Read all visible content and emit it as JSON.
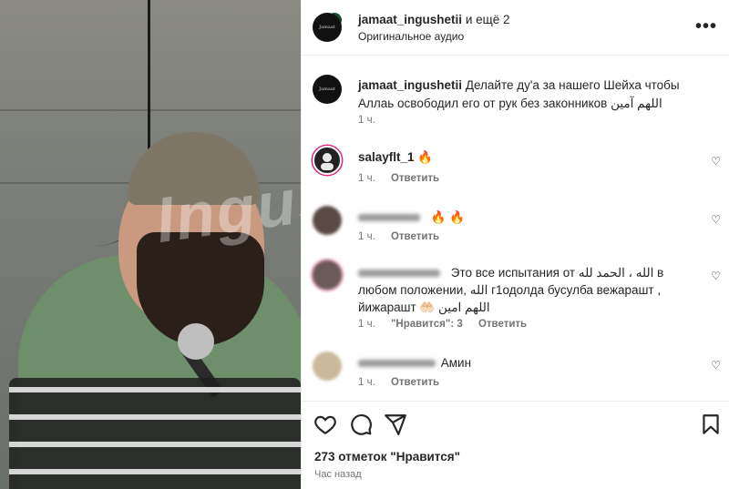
{
  "media": {
    "watermark": "Ingushka"
  },
  "header": {
    "account": "jamaat_ingushetii",
    "more_accounts": "и ещё 2",
    "audio": "Оригинальное аудио",
    "more_icon": "more-icon"
  },
  "caption": {
    "user": "jamaat_ingushetii",
    "text": "Делайте ду'а за нашего Шейха чтобы Аллаь освободил его от рук без законников اللهم آمين",
    "time": "1 ч."
  },
  "comments": [
    {
      "user": "salayflt_1",
      "text": "🔥",
      "time": "1 ч.",
      "reply": "Ответить",
      "likes": ""
    },
    {
      "user": "",
      "text": "🔥 🔥",
      "time": "1 ч.",
      "reply": "Ответить",
      "likes": ""
    },
    {
      "user": "",
      "text": "Это все испытания от الله ، الحمد لله в любом положении, الله г1одолда бусулба вежарашт , йижарашт 🤲🏻 اللهم امين",
      "time": "1 ч.",
      "likes": "\"Нравится\": 3",
      "reply": "Ответить"
    },
    {
      "user": "",
      "text": "Амин",
      "time": "1 ч.",
      "reply": "Ответить",
      "likes": ""
    }
  ],
  "footer": {
    "likes": "273 отметок \"Нравится\"",
    "posted": "Час назад"
  },
  "colors": {
    "text": "#262626",
    "secondary": "#737373",
    "divider": "#efefef"
  }
}
